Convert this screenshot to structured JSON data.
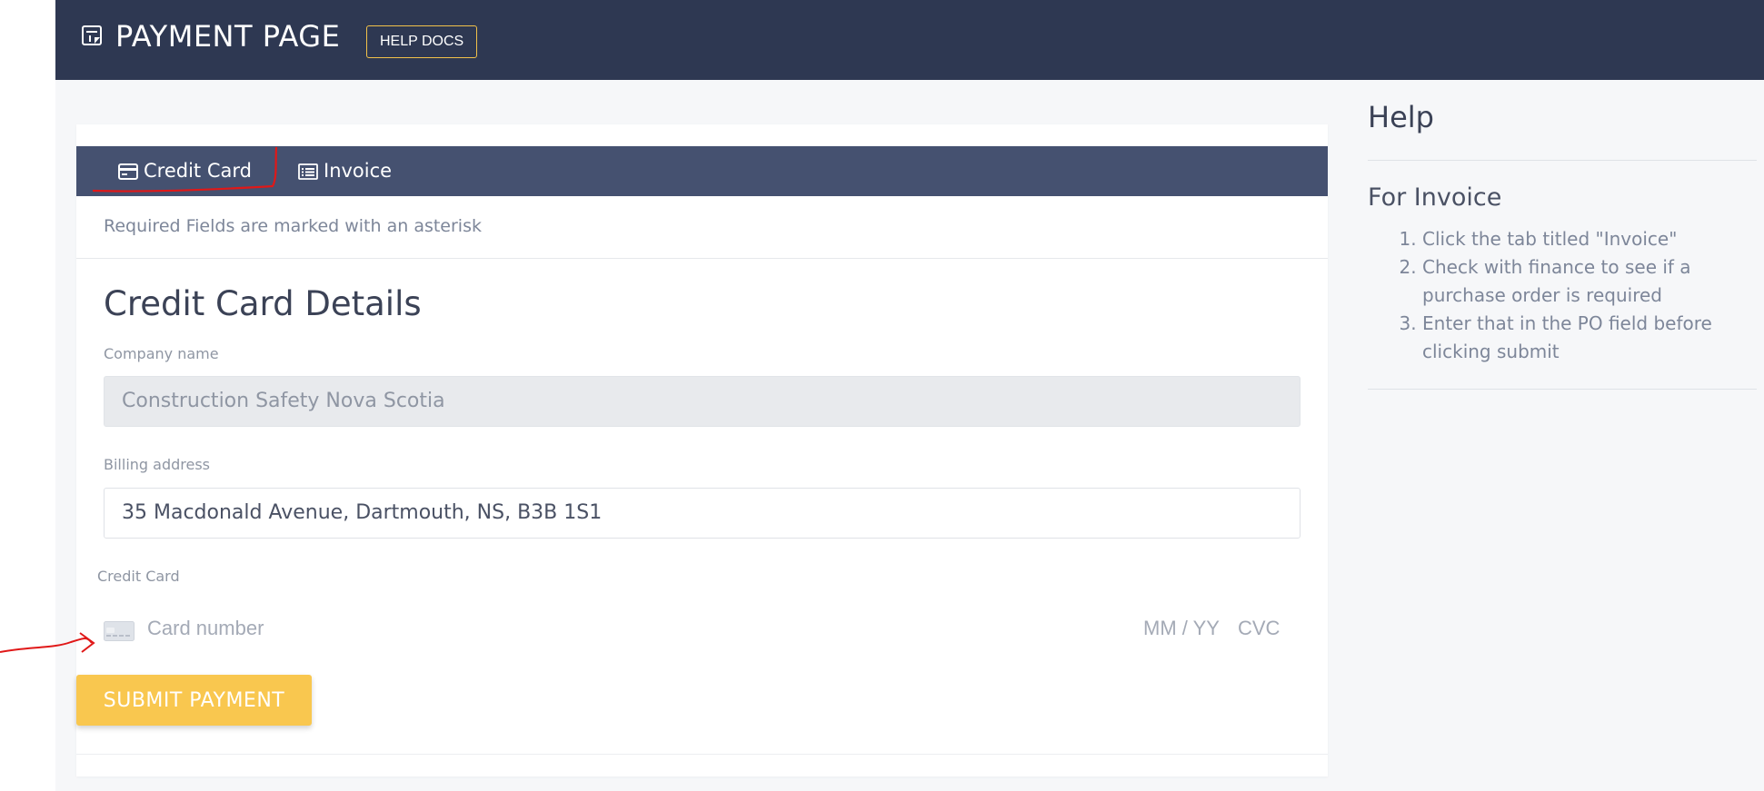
{
  "header": {
    "title": "PAYMENT PAGE",
    "help_docs_label": "HELP DOCS",
    "logo_icon": "receipt-icon",
    "background": "#2e3852",
    "accent": "#f2c24a"
  },
  "tabs": [
    {
      "label": "Credit Card",
      "icon": "credit-card-icon",
      "active": true
    },
    {
      "label": "Invoice",
      "icon": "list-icon",
      "active": false
    }
  ],
  "form": {
    "required_note": "Required Fields are marked with an asterisk",
    "section_title": "Credit Card Details",
    "company": {
      "label": "Company name",
      "value": "Construction Safety Nova Scotia"
    },
    "billing": {
      "label": "Billing address",
      "value": "35 Macdonald Avenue, Dartmouth, NS, B3B 1S1"
    },
    "credit_card": {
      "label": "Credit Card",
      "number_placeholder": "Card number",
      "expiry_placeholder": "MM / YY",
      "cvc_placeholder": "CVC"
    },
    "submit_label": "SUBMIT PAYMENT",
    "submit_color": "#f9c74f"
  },
  "help": {
    "title": "Help",
    "subtitle": "For Invoice",
    "steps": [
      "Click the tab titled \"Invoice\"",
      "Check with finance to see if a purchase order is required",
      "Enter that in the PO field before clicking submit"
    ]
  }
}
